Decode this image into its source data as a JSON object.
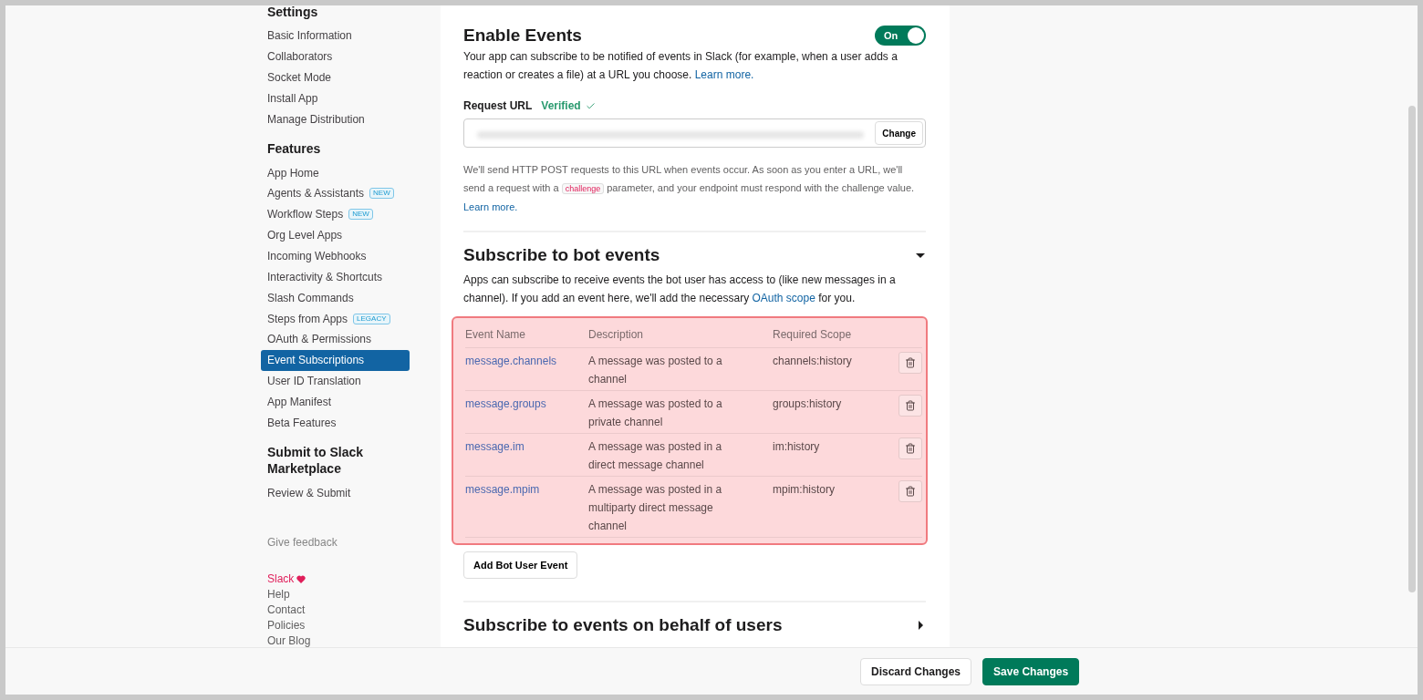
{
  "sidebar": {
    "sections": [
      {
        "heading": "Settings",
        "items": [
          {
            "label": "Basic Information",
            "selected": false
          },
          {
            "label": "Collaborators",
            "selected": false
          },
          {
            "label": "Socket Mode",
            "selected": false
          },
          {
            "label": "Install App",
            "selected": false
          },
          {
            "label": "Manage Distribution",
            "selected": false
          }
        ]
      },
      {
        "heading": "Features",
        "items": [
          {
            "label": "App Home",
            "selected": false
          },
          {
            "label": "Agents & Assistants",
            "badge": "NEW",
            "selected": false
          },
          {
            "label": "Workflow Steps",
            "badge": "NEW",
            "selected": false
          },
          {
            "label": "Org Level Apps",
            "selected": false
          },
          {
            "label": "Incoming Webhooks",
            "selected": false
          },
          {
            "label": "Interactivity & Shortcuts",
            "selected": false
          },
          {
            "label": "Slash Commands",
            "selected": false
          },
          {
            "label": "Steps from Apps",
            "badge": "LEGACY",
            "selected": false
          },
          {
            "label": "OAuth & Permissions",
            "selected": false
          },
          {
            "label": "Event Subscriptions",
            "selected": true
          },
          {
            "label": "User ID Translation",
            "selected": false
          },
          {
            "label": "App Manifest",
            "selected": false
          },
          {
            "label": "Beta Features",
            "selected": false
          }
        ]
      },
      {
        "heading": "Submit to Slack Marketplace",
        "items": [
          {
            "label": "Review & Submit",
            "selected": false
          }
        ]
      }
    ],
    "feedback": "Give feedback",
    "footer_links": [
      {
        "label": "Slack",
        "kind": "brand"
      },
      {
        "label": "Help",
        "kind": "link"
      },
      {
        "label": "Contact",
        "kind": "link"
      },
      {
        "label": "Policies",
        "kind": "link"
      },
      {
        "label": "Our Blog",
        "kind": "link"
      }
    ]
  },
  "enable_events": {
    "title": "Enable Events",
    "toggle": {
      "label": "On",
      "on": true
    },
    "description": [
      {
        "kind": "text",
        "text": "Your app can subscribe to be notified of events in Slack (for example, when a user adds a reaction or creates a file) at a URL you choose. "
      },
      {
        "kind": "link",
        "text": "Learn more."
      }
    ],
    "request_url": {
      "label": "Request URL",
      "status": "Verified",
      "button": "Change"
    },
    "note": [
      {
        "kind": "text",
        "text": "We'll send HTTP POST requests to this URL when events occur. As soon as you enter a URL, we'll send a request with a "
      },
      {
        "kind": "code",
        "text": "challenge"
      },
      {
        "kind": "text",
        "text": " parameter, and your endpoint must respond with the challenge value. "
      },
      {
        "kind": "link",
        "text": "Learn more."
      }
    ]
  },
  "bot_events": {
    "title": "Subscribe to bot events",
    "expanded": true,
    "description": [
      {
        "kind": "text",
        "text": "Apps can subscribe to receive events the bot user has access to (like new messages in a channel). If you add an event here, we'll add the necessary "
      },
      {
        "kind": "link",
        "text": "OAuth scope"
      },
      {
        "kind": "text",
        "text": " for you."
      }
    ],
    "table": {
      "highlighted": true,
      "columns": [
        "Event Name",
        "Description",
        "Required Scope"
      ],
      "rows": [
        {
          "event": "message.channels",
          "description": "A message was posted to a channel",
          "scope": "channels:history"
        },
        {
          "event": "message.groups",
          "description": "A message was posted to a private channel",
          "scope": "groups:history"
        },
        {
          "event": "message.im",
          "description": "A message was posted in a direct message channel",
          "scope": "im:history"
        },
        {
          "event": "message.mpim",
          "description": "A message was posted in a multiparty direct message channel",
          "scope": "mpim:history"
        }
      ]
    },
    "add_button": "Add Bot User Event"
  },
  "user_events": {
    "title": "Subscribe to events on behalf of users",
    "expanded": false
  },
  "footer_buttons": [
    {
      "label": "Discard Changes",
      "kind": "secondary"
    },
    {
      "label": "Save Changes",
      "kind": "primary"
    }
  ]
}
